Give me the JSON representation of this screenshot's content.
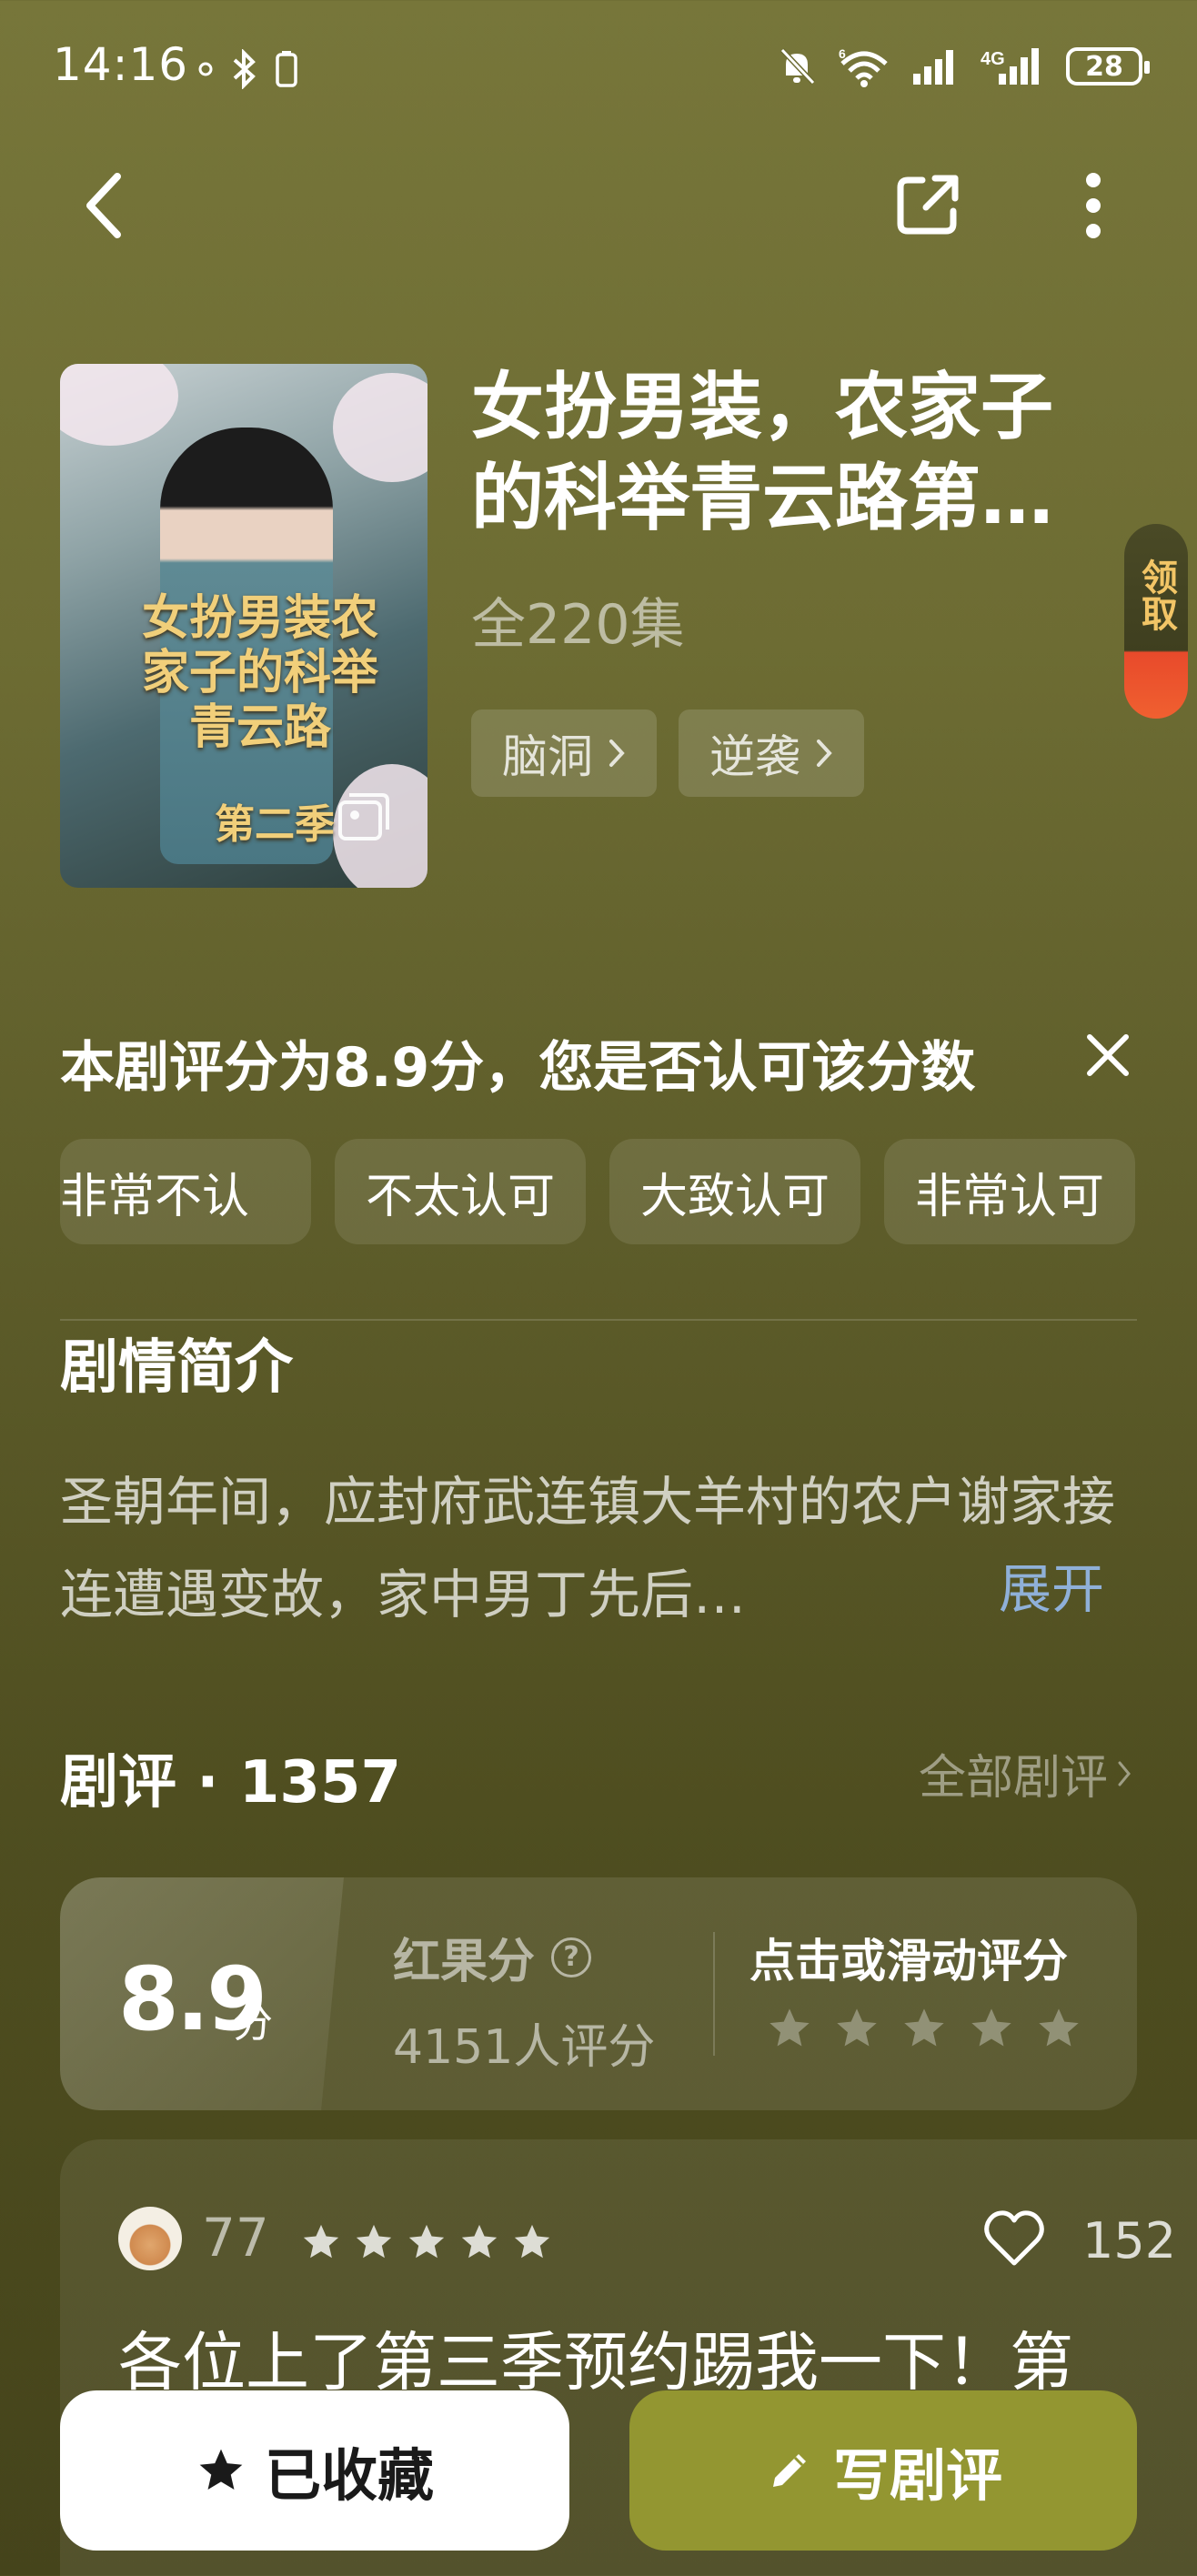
{
  "status_bar": {
    "time": "14:16",
    "network_label": "4G",
    "wifi_label": "6",
    "battery": "28"
  },
  "top_bar": {
    "back_icon": "chevron-left-icon",
    "share_icon": "share-icon",
    "more_icon": "more-vertical-icon"
  },
  "show": {
    "cover_title": "女扮男装农家子的科举青云路",
    "cover_season": "第二季",
    "title": "女扮男装，农家子的科举青云路第…",
    "episodes": "全220集",
    "tags": [
      {
        "label": "脑洞"
      },
      {
        "label": "逆袭"
      }
    ],
    "reward_tab": "领取"
  },
  "rating_prompt": {
    "question": "本剧评分为8.9分，您是否认可该分数",
    "options": [
      "非常不认",
      "不太认可",
      "大致认可",
      "非常认可"
    ]
  },
  "synopsis": {
    "title": "剧情简介",
    "text": "圣朝年间，应封府武连镇大羊村的农户谢家接连遭遇变故，家中男丁先后…",
    "expand_label": "展开"
  },
  "reviews": {
    "header": "剧评 · 1357",
    "all_label": "全部剧评",
    "score": "8.9",
    "score_unit": "分",
    "score_name": "红果分",
    "raters": "4151人评分",
    "tap_to_rate": "点击或滑动评分",
    "first_review": {
      "user": "77",
      "stars": 5,
      "likes": "152",
      "text": "各位上了第三季预约踢我一下！第"
    }
  },
  "bottom_bar": {
    "favorited_label": "已收藏",
    "write_review_label": "写剧评"
  },
  "colors": {
    "background": "#6d6c33",
    "accent": "#939631",
    "link": "#8fb0d8"
  }
}
